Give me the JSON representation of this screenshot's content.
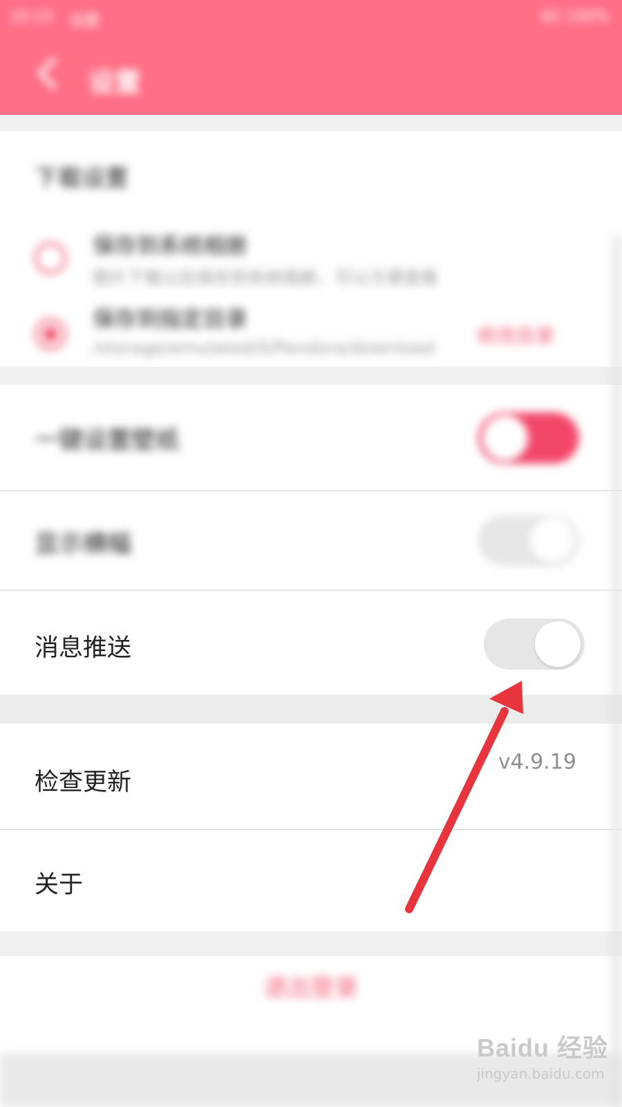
{
  "status_bar": {
    "time": "10:15",
    "carrier": "设置",
    "right": "4G 100%"
  },
  "app_bar": {
    "title": "设置"
  },
  "download": {
    "header": "下载设置",
    "options": [
      {
        "title": "保存到系统相册",
        "desc": "图片下载以后保存到系统相册，可以方便查看",
        "checked": false
      },
      {
        "title": "保存到指定目录",
        "desc": "/storage/emulated/0/Pandora/download",
        "checked": true,
        "action": "修改目录"
      }
    ]
  },
  "rows": {
    "one_click": {
      "label": "一键设置壁纸",
      "on": true
    },
    "show_ads": {
      "label": "显示横幅",
      "on": false
    },
    "push": {
      "label": "消息推送",
      "on": false
    },
    "update": {
      "label": "检查更新",
      "value": "v4.9.19"
    },
    "about": {
      "label": "关于"
    }
  },
  "logout": "退出登录",
  "watermark": {
    "brand": "Baidu 经验",
    "url": "jingyan.baidu.com"
  },
  "colors": {
    "brand": "#ff6f86",
    "accent": "#f35a74",
    "arrow": "#e8343c"
  }
}
